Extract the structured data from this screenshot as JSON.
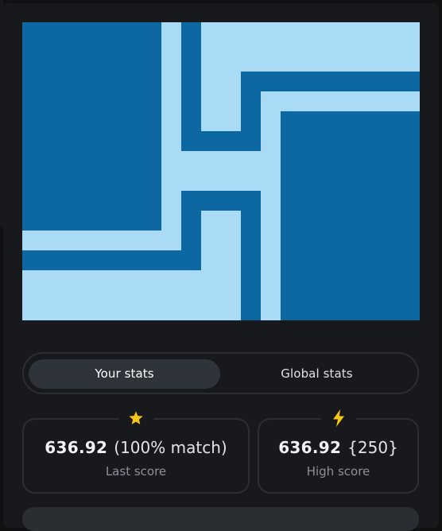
{
  "colors": {
    "art_light": "#a9dbf7",
    "art_dark": "#0d67a0",
    "panel_bg": "#17191c",
    "accent_star": "#f5c518",
    "accent_bolt": "#f5c518"
  },
  "tabs": {
    "your_stats": "Your stats",
    "global_stats": "Global stats",
    "active": "Your stats"
  },
  "last_score": {
    "icon": "star-icon",
    "value": "636.92",
    "extra": "(100% match)",
    "label": "Last score"
  },
  "high_score": {
    "icon": "bolt-icon",
    "value": "636.92",
    "extra": "{250}",
    "label": "High score"
  }
}
